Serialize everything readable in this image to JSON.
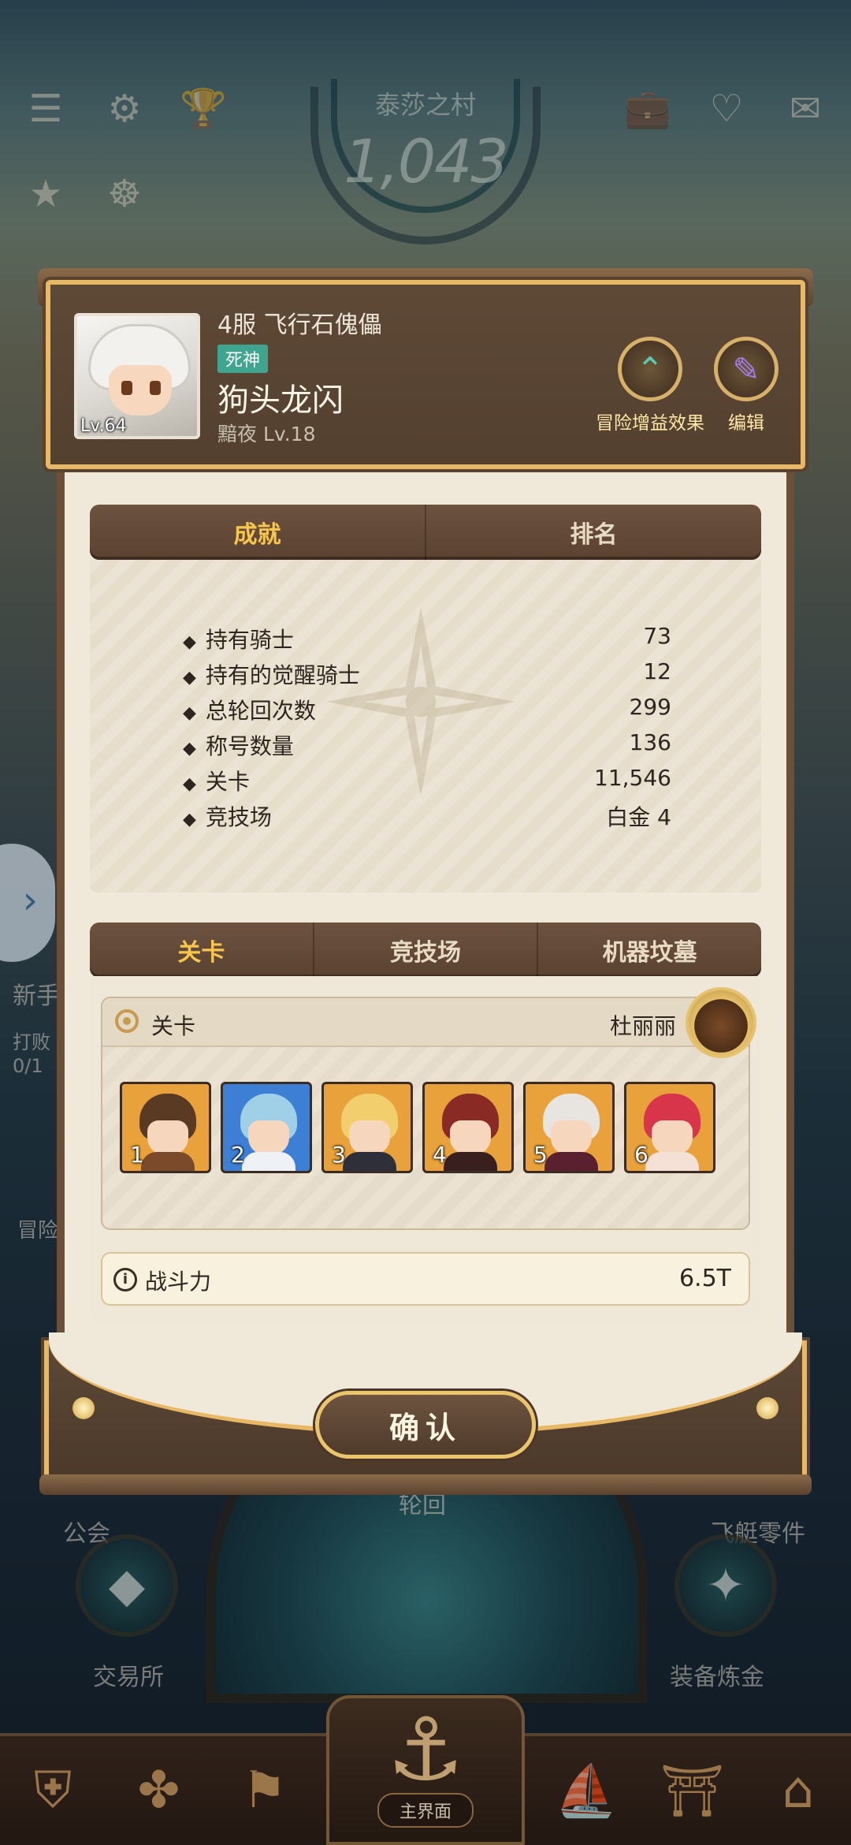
{
  "background": {
    "village_name": "泰莎之村",
    "score": "1,043",
    "labels": {
      "guild": "公会",
      "exchange": "交易所",
      "airship_parts": "飞艇零件",
      "equipment_alchemy": "装备炼金",
      "reincarnation": "轮回",
      "newbie": "新手",
      "defeat": "打败",
      "progress": "0/1",
      "adventure": "冒险"
    },
    "bottom_nav_center": "主界面"
  },
  "profile": {
    "server_title": "4服 飞行石傀儡",
    "tag": "死神",
    "name": "狗头龙闪",
    "guild_line": "黯夜 Lv.18",
    "avatar_level": "Lv.64",
    "buttons": {
      "buff": "冒险增益效果",
      "edit": "编辑"
    }
  },
  "tabs_top": [
    {
      "label": "成就",
      "active": true
    },
    {
      "label": "排名",
      "active": false
    }
  ],
  "stats": [
    {
      "label": "持有骑士",
      "value": "73"
    },
    {
      "label": "持有的觉醒骑士",
      "value": "12"
    },
    {
      "label": "总轮回次数",
      "value": "299"
    },
    {
      "label": "称号数量",
      "value": "136"
    },
    {
      "label": "关卡",
      "value": "11,546"
    },
    {
      "label": "竞技场",
      "value": "白金 4"
    }
  ],
  "tabs_bottom": [
    {
      "label": "关卡",
      "active": true
    },
    {
      "label": "竞技场",
      "active": false
    },
    {
      "label": "机器坟墓",
      "active": false
    }
  ],
  "stage": {
    "label": "关卡",
    "boss_name": "杜丽丽",
    "heroes": [
      "1",
      "2",
      "3",
      "4",
      "5",
      "6"
    ],
    "power_label": "战斗力",
    "power_value": "6.5T"
  },
  "confirm_label": "确认",
  "colors": {
    "accent_gold": "#f7c64e",
    "frame_brown": "#5e4937",
    "tag_teal": "#3fa58f"
  }
}
